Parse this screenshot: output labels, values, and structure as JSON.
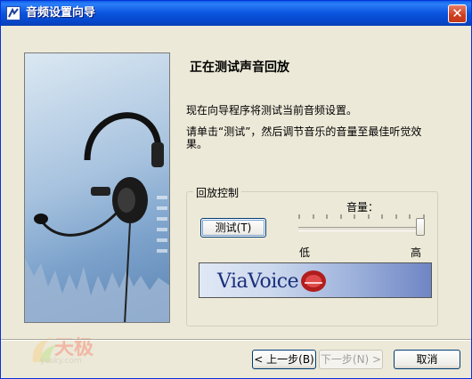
{
  "window": {
    "title": "音频设置向导",
    "close_glyph": "✕"
  },
  "page": {
    "heading": "正在测试声音回放",
    "intro": "现在向导程序将测试当前音频设置。",
    "instruction_line1": "请单击“测试”，然后调节音乐的音量至最佳听觉效",
    "instruction_line2": "果。"
  },
  "playback": {
    "group_label": "回放控制",
    "test_button": "测试(T)",
    "volume_label": "音量：",
    "low_label": "低",
    "high_label": "高",
    "volume_level": 1.0,
    "tick_count": 10,
    "logo_text": "ViaVoice"
  },
  "buttons": {
    "back": "< 上一步(B)",
    "next": "下一步(N) >",
    "cancel": "取消"
  },
  "watermark": {
    "brand": "天极",
    "sub": "yesky.com"
  },
  "colors": {
    "titlebar": "#0a54de",
    "dialog_bg": "#ece9d8",
    "accent_red": "#c3391a"
  },
  "icons": [
    "app-icon",
    "close-icon",
    "headset-illustration",
    "viavoice-logo"
  ]
}
